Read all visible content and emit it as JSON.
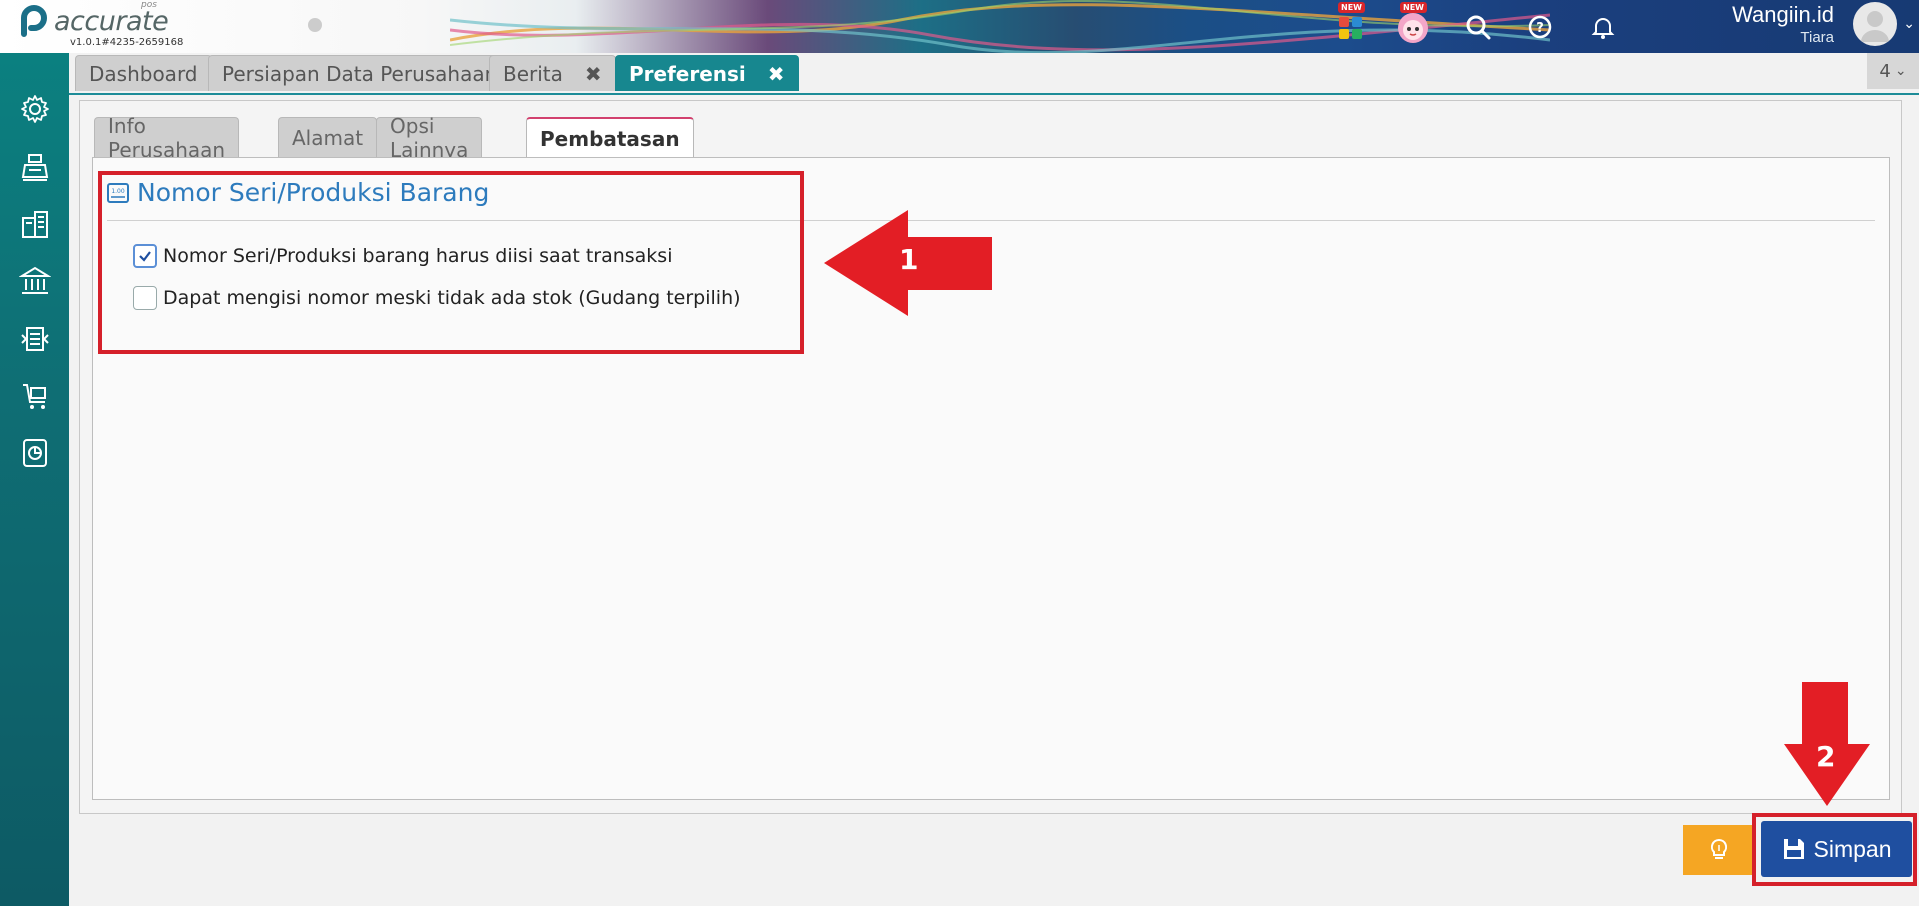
{
  "app": {
    "logo_text": "accurate",
    "logo_sub": "pos",
    "version": "v1.0.1#4235-2659168"
  },
  "header": {
    "new_badge": "NEW",
    "user_name": "Wangiin.id",
    "user_sub": "Tiara",
    "icons": [
      "apps-icon",
      "mascot-icon",
      "search-icon",
      "help-icon",
      "bell-icon"
    ]
  },
  "sidebar": {
    "items": [
      "settings-icon",
      "cashier-icon",
      "company-icon",
      "bank-icon",
      "inventory-icon",
      "cart-icon",
      "report-icon"
    ]
  },
  "main_tabs": [
    {
      "label": "Dashboard"
    },
    {
      "label": "Persiapan Data Perusahaan"
    },
    {
      "label": "Berita"
    },
    {
      "label": "Preferensi"
    }
  ],
  "tab_count": "4",
  "sub_tabs": [
    {
      "label": "Info Perusahaan"
    },
    {
      "label": "Alamat"
    },
    {
      "label": "Opsi Lainnya"
    },
    {
      "label": "Pembatasan"
    }
  ],
  "section": {
    "title": "Nomor Seri/Produksi Barang",
    "options": [
      {
        "label": "Nomor Seri/Produksi barang harus diisi saat transaksi",
        "checked": true
      },
      {
        "label": "Dapat mengisi nomor meski tidak ada stok (Gudang terpilih)",
        "checked": false
      }
    ]
  },
  "annotations": {
    "one": "1",
    "two": "2"
  },
  "footer": {
    "save_label": "Simpan"
  },
  "colors": {
    "teal": "#17878f",
    "save": "#1f4fa0",
    "tip": "#f5a623",
    "annotation": "#d5202a",
    "section_title": "#2d7bbd"
  }
}
